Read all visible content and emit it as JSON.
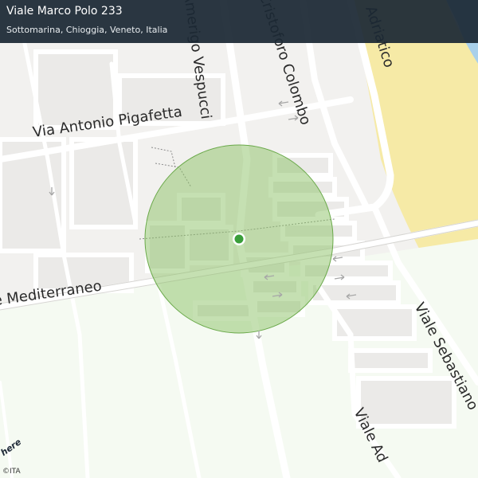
{
  "header": {
    "title": "Viale Marco Polo 233",
    "subtitle": "Sottomarina, Chioggia, Veneto, Italia"
  },
  "map": {
    "streets": [
      "Via Antonio Pigafetta",
      "Viale Mediterraneo",
      "Viale Amerigo Vespucci",
      "Viale Cristoforo Colombo",
      "Adriatico",
      "Viale Sebastiano",
      "Viale Ad"
    ],
    "colors": {
      "accuracy_circle": "#8cc266",
      "location_marker": "#3a9e3a",
      "beach": "#f6eaa6",
      "park": "#f5faf2",
      "water": "#a9d0ea"
    }
  },
  "attribution": "©ITA",
  "logo": "here"
}
